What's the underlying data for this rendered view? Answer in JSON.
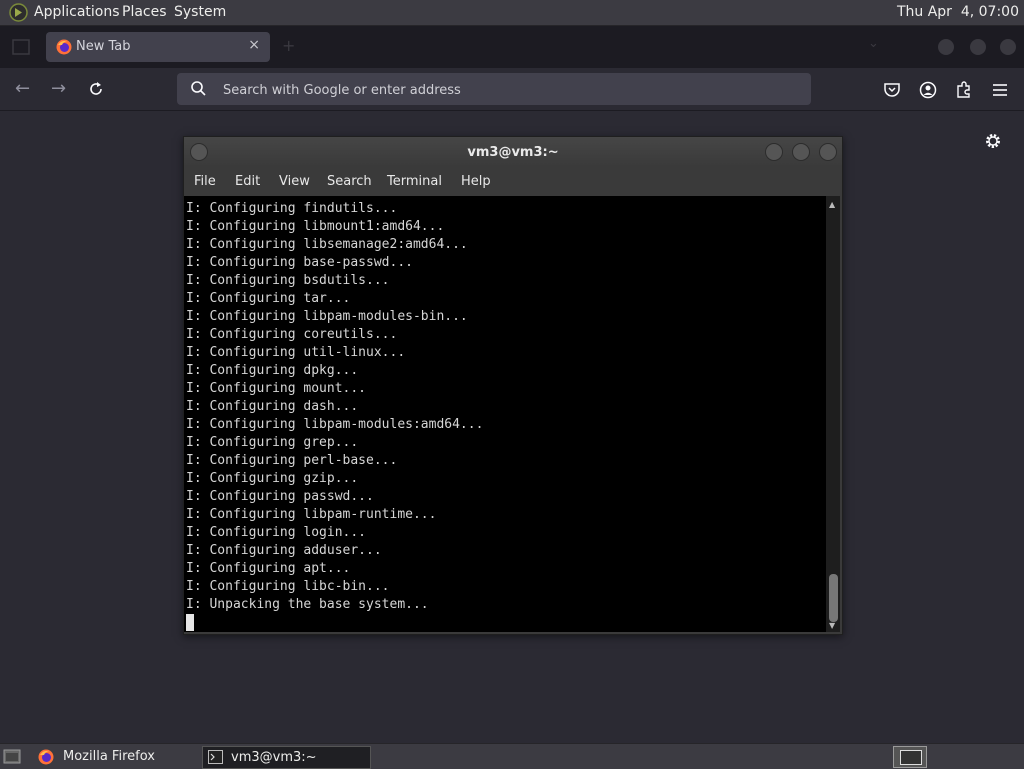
{
  "top_panel": {
    "menus": [
      "Applications",
      "Places",
      "System"
    ],
    "clock": "Thu Apr  4, 07:00"
  },
  "browser": {
    "tab_title": "New Tab",
    "tab_close": "×",
    "search_placeholder": "Search with Google or enter address",
    "nav": {
      "back": "←",
      "forward": "→"
    }
  },
  "terminal": {
    "title": "vm3@vm3:~",
    "menu": [
      "File",
      "Edit",
      "View",
      "Search",
      "Terminal",
      "Help"
    ],
    "lines": [
      "I: Configuring findutils...",
      "I: Configuring libmount1:amd64...",
      "I: Configuring libsemanage2:amd64...",
      "I: Configuring base-passwd...",
      "I: Configuring bsdutils...",
      "I: Configuring tar...",
      "I: Configuring libpam-modules-bin...",
      "I: Configuring coreutils...",
      "I: Configuring util-linux...",
      "I: Configuring dpkg...",
      "I: Configuring mount...",
      "I: Configuring dash...",
      "I: Configuring libpam-modules:amd64...",
      "I: Configuring grep...",
      "I: Configuring perl-base...",
      "I: Configuring gzip...",
      "I: Configuring passwd...",
      "I: Configuring libpam-runtime...",
      "I: Configuring login...",
      "I: Configuring adduser...",
      "I: Configuring apt...",
      "I: Configuring libc-bin...",
      "I: Unpacking the base system..."
    ]
  },
  "taskbar": {
    "tasks": [
      {
        "label": "Mozilla Firefox",
        "icon": "firefox-icon"
      },
      {
        "label": "vm3@vm3:~",
        "icon": "terminal-icon"
      }
    ]
  }
}
